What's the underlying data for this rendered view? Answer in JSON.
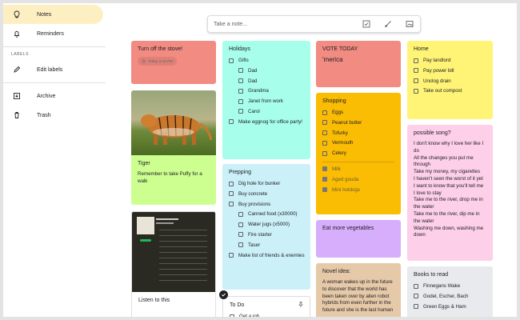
{
  "colors": {
    "red": "#f28b82",
    "teal": "#a7ffeb",
    "green": "#ccff90",
    "blue": "#cbf0f8",
    "orange": "#fbbc04",
    "yellow": "#fff475",
    "pink": "#fdcfe8",
    "purple": "#d7aefb",
    "brown": "#e6c9a8",
    "gray": "#e8eaed",
    "dark": "#202124",
    "active_nav": "#feefc3"
  },
  "sidebar": {
    "items": [
      {
        "label": "Notes",
        "icon": "lightbulb-icon"
      },
      {
        "label": "Reminders",
        "icon": "bell-icon"
      }
    ],
    "labels_header": "LABELS",
    "edit_labels": "Edit labels",
    "bottom": [
      {
        "label": "Archive",
        "icon": "archive-icon"
      },
      {
        "label": "Trash",
        "icon": "trash-icon"
      }
    ]
  },
  "take_note": {
    "placeholder": "Take a note...",
    "tools": [
      "checkbox-icon",
      "brush-icon",
      "image-icon"
    ]
  },
  "notes": {
    "stove": {
      "title": "Turn off the stove!",
      "chip": "Today, 5:15 PM"
    },
    "holidays": {
      "title": "Holidays",
      "items": [
        "Gifts",
        "Dad",
        "Dad",
        "Grandma",
        "Janet from work",
        "Carol",
        "Make eggnog for office party!"
      ]
    },
    "vote": {
      "title": "VOTE TODAY",
      "text": "'merica"
    },
    "home": {
      "title": "Home",
      "items": [
        "Pay landlord",
        "Pay power bill",
        "Unclog drain",
        "Take out compost"
      ]
    },
    "tiger": {
      "title": "Tiger",
      "text": "Remember to take Puffy for a walk"
    },
    "shopping": {
      "title": "Shopping",
      "items": [
        "Eggs",
        "Peanut butter",
        "Tofurky",
        "Vermouth",
        "Celery"
      ],
      "done": [
        "Milk",
        "Aged gouda",
        "Mini hotdogs"
      ]
    },
    "song": {
      "title": "possible song?",
      "text": "I don't know why I love her like I do\nAll the changes you put me through\nTake my money, my cigarettes\nI haven't seen the worst of it yet\nI want to know that you'll tell me\nI love to stay\nTake me to the river, drop me in the water\nTake me to the river, dip me in the water\nWashing me down, washing me down"
    },
    "prepping": {
      "title": "Prepping",
      "items": [
        "Dig hole for bunker",
        "Buy concrete",
        "Buy provisions",
        "Canned food (x30000)",
        "Water jugs (x5000)",
        "Fire starter",
        "Taser",
        "Make list of friends & enemies"
      ]
    },
    "veg": {
      "title": "Eat more vegetables"
    },
    "listen": {
      "title": "Listen to this",
      "album_title": "Songs from Charles Weathers",
      "tracks": 9
    },
    "todo": {
      "title": "To Do",
      "items": [
        "Get a job"
      ]
    },
    "novel": {
      "title": "Novel idea:",
      "text": "A woman wakes up in the future to discover that the world has been taken over by alien robot hybrids from even further in the future and she is the last human"
    },
    "books": {
      "title": "Books to read",
      "items": [
        "Finnegans Wake",
        "Godel, Escher, Bach",
        "Green Eggs & Ham"
      ]
    }
  }
}
